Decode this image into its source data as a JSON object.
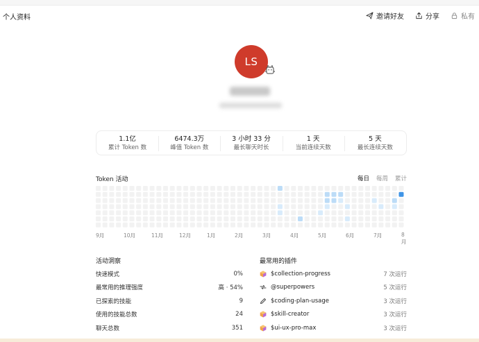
{
  "header": {
    "title": "个人资料",
    "invite_label": "邀请好友",
    "share_label": "分享",
    "private_label": "私有"
  },
  "profile": {
    "initials": "LS",
    "avatar_color": "#cf3b2b"
  },
  "stats": [
    {
      "value": "1.1亿",
      "label": "累计 Token 数"
    },
    {
      "value": "6474.3万",
      "label": "峰值 Token 数"
    },
    {
      "value": "3 小时 33 分",
      "label": "最长聊天时长"
    },
    {
      "value": "1 天",
      "label": "当前连续天数"
    },
    {
      "value": "5 天",
      "label": "最长连续天数"
    }
  ],
  "activity": {
    "title": "Token 活动",
    "tabs": [
      {
        "label": "每日",
        "active": true
      },
      {
        "label": "每周",
        "active": false
      },
      {
        "label": "累计",
        "active": false
      }
    ],
    "months": [
      "9月",
      "10月",
      "11月",
      "12月",
      "1月",
      "2月",
      "3月",
      "4月",
      "5月",
      "6月",
      "7月",
      "8月"
    ],
    "grid": {
      "columns": 46,
      "rows": 7,
      "empty_color": "#f2f2f2",
      "levels": [
        "#f2f2f2",
        "#d8ebfb",
        "#bcdcf7",
        "#8cc2f0",
        "#3f94e6"
      ],
      "active_cells": [
        {
          "col": 27,
          "row": 0,
          "level": 2
        },
        {
          "col": 34,
          "row": 1,
          "level": 2
        },
        {
          "col": 35,
          "row": 1,
          "level": 2
        },
        {
          "col": 36,
          "row": 1,
          "level": 2
        },
        {
          "col": 45,
          "row": 1,
          "level": 4
        },
        {
          "col": 34,
          "row": 2,
          "level": 2
        },
        {
          "col": 35,
          "row": 2,
          "level": 2
        },
        {
          "col": 36,
          "row": 2,
          "level": 1
        },
        {
          "col": 41,
          "row": 2,
          "level": 1
        },
        {
          "col": 44,
          "row": 2,
          "level": 2
        },
        {
          "col": 27,
          "row": 3,
          "level": 1
        },
        {
          "col": 34,
          "row": 3,
          "level": 1
        },
        {
          "col": 37,
          "row": 3,
          "level": 1
        },
        {
          "col": 42,
          "row": 3,
          "level": 1
        },
        {
          "col": 44,
          "row": 3,
          "level": 1
        },
        {
          "col": 27,
          "row": 4,
          "level": 1
        },
        {
          "col": 33,
          "row": 4,
          "level": 1
        },
        {
          "col": 30,
          "row": 5,
          "level": 2
        },
        {
          "col": 37,
          "row": 5,
          "level": 1
        }
      ]
    }
  },
  "insights": {
    "title": "活动洞察",
    "rows": [
      {
        "label": "快速模式",
        "value": "0%"
      },
      {
        "label": "最常用的推理强度",
        "value": "高 · 54%"
      },
      {
        "label": "已探索的技能",
        "value": "9"
      },
      {
        "label": "使用的技能总数",
        "value": "24"
      },
      {
        "label": "聊天总数",
        "value": "351"
      }
    ]
  },
  "plugins": {
    "title": "最常用的插件",
    "rows": [
      {
        "name": "$collection-progress",
        "runs": "7 次运行",
        "icon": "cube-icon"
      },
      {
        "name": "@superpowers",
        "runs": "5 次运行",
        "icon": "link-icon"
      },
      {
        "name": "$coding-plan-usage",
        "runs": "3 次运行",
        "icon": "pencil-icon"
      },
      {
        "name": "$skill-creator",
        "runs": "3 次运行",
        "icon": "cube-icon"
      },
      {
        "name": "$ui-ux-pro-max",
        "runs": "3 次运行",
        "icon": "cube-icon"
      }
    ]
  }
}
